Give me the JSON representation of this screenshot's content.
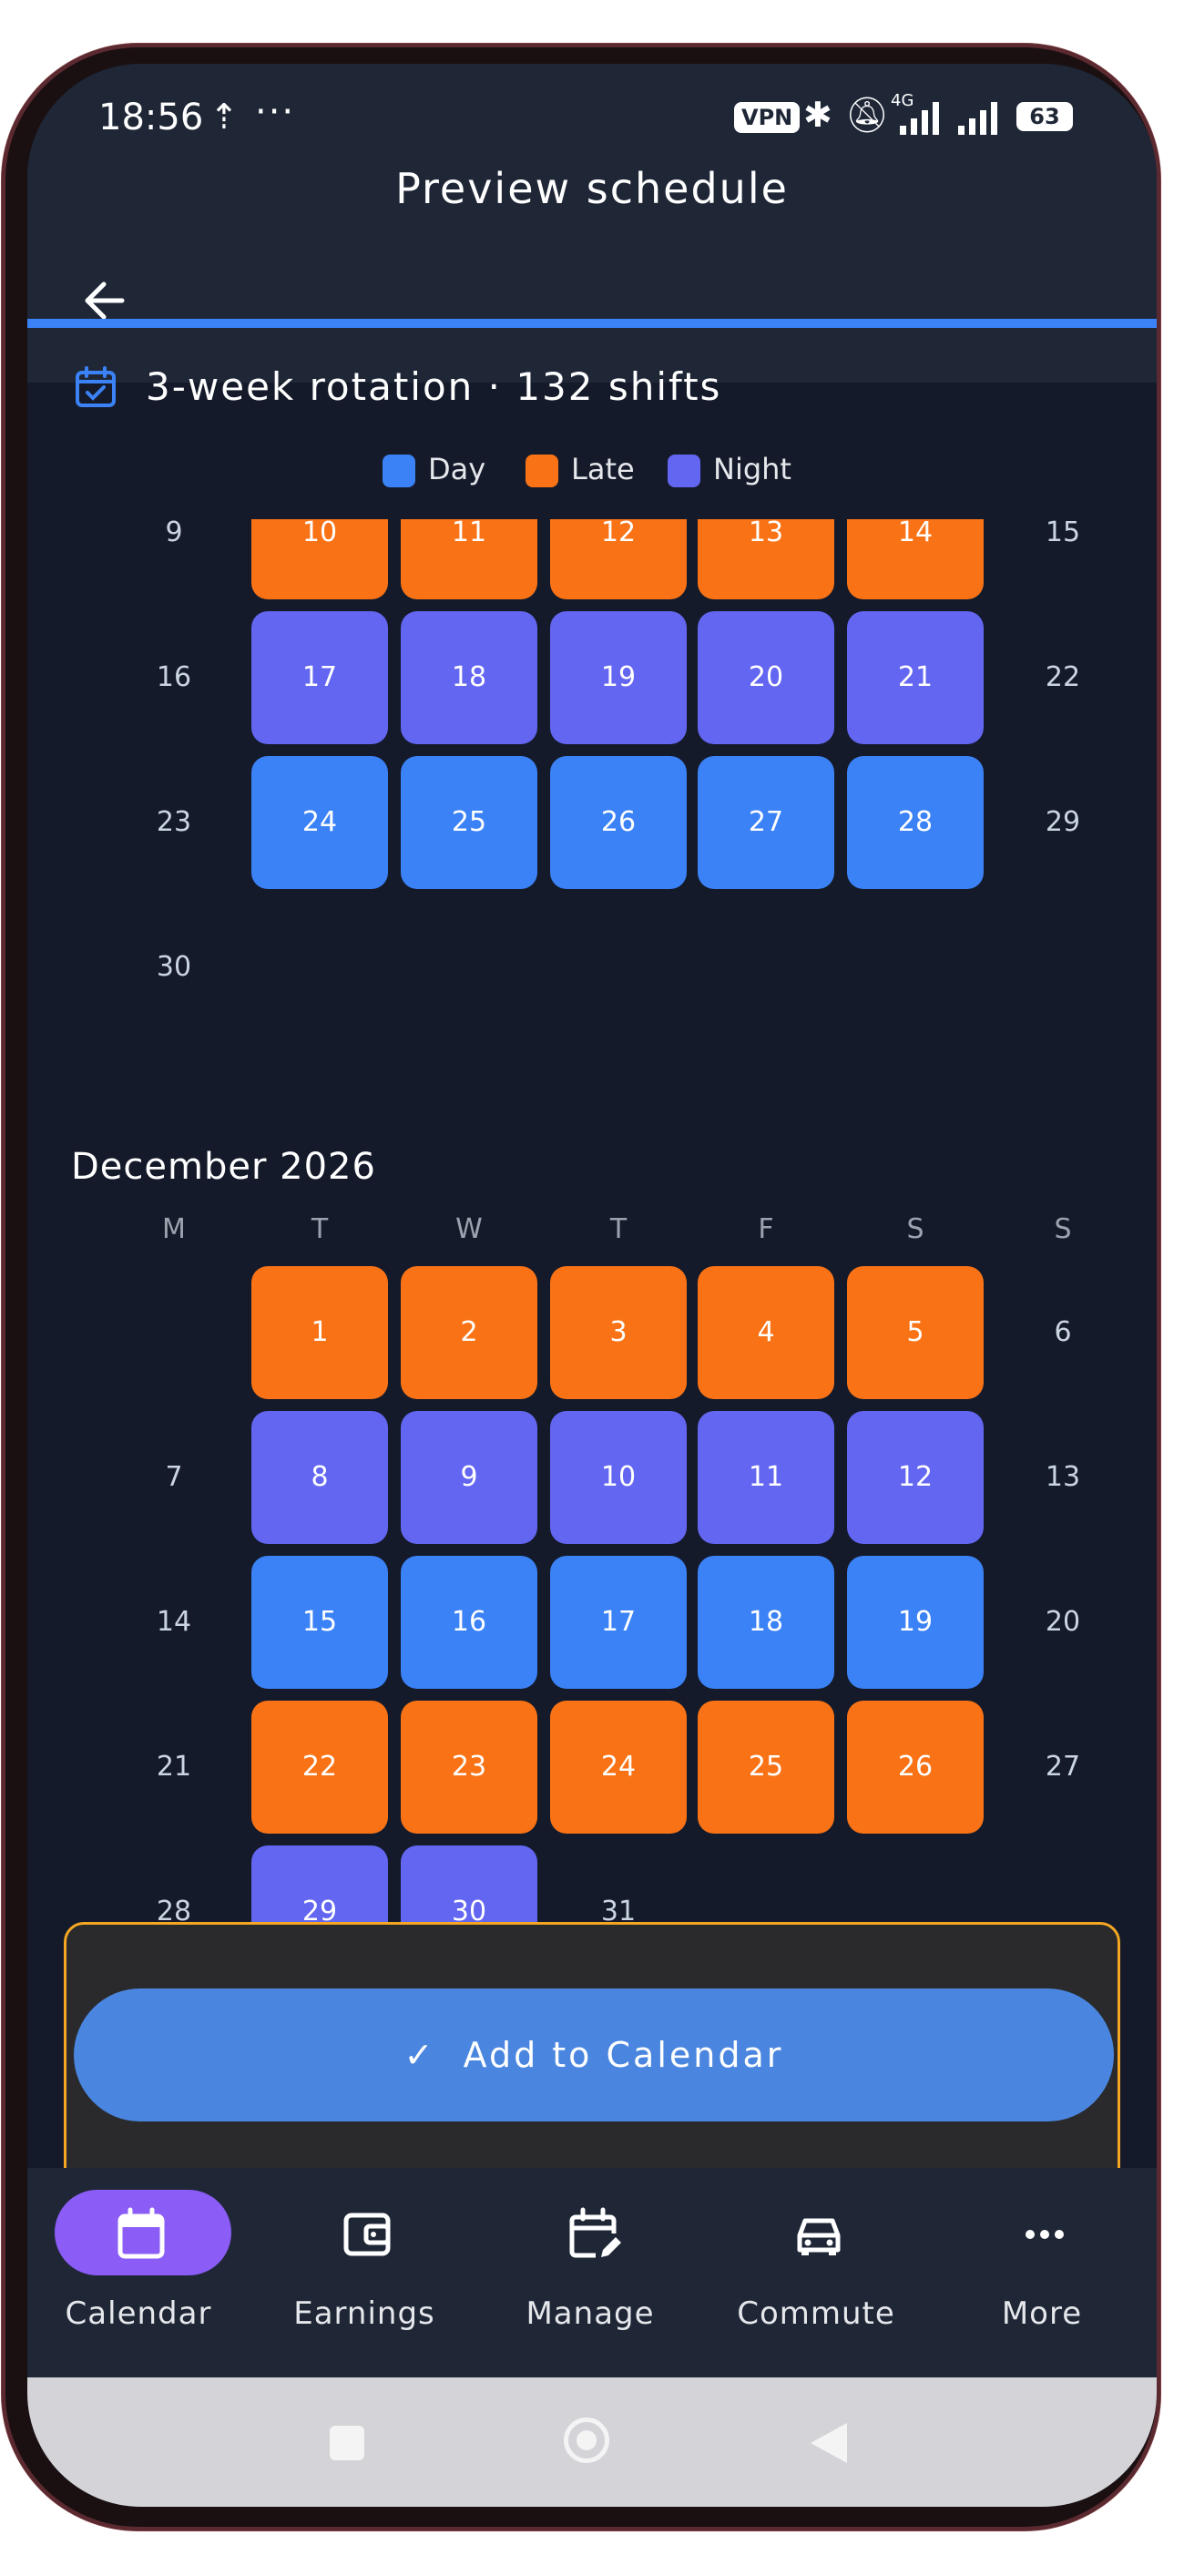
{
  "status_bar": {
    "time": "18:56",
    "vpn": "VPN",
    "network": "4G",
    "battery": "63"
  },
  "app_bar": {
    "title": "Preview schedule"
  },
  "summary": {
    "text": "3-week rotation · 132 shifts"
  },
  "legend": {
    "day": "Day",
    "late": "Late",
    "night": "Night"
  },
  "colors": {
    "day": "#3b82f6",
    "late": "#f97316",
    "night": "#6366f1",
    "accent": "#3b82f6",
    "nav_active": "#8b5cf6",
    "highlight_border": "#f5a623"
  },
  "november": {
    "weeks": [
      [
        {
          "d": "9",
          "s": ""
        },
        {
          "d": "10",
          "s": "late"
        },
        {
          "d": "11",
          "s": "late"
        },
        {
          "d": "12",
          "s": "late"
        },
        {
          "d": "13",
          "s": "late"
        },
        {
          "d": "14",
          "s": "late"
        },
        {
          "d": "15",
          "s": ""
        }
      ],
      [
        {
          "d": "16",
          "s": ""
        },
        {
          "d": "17",
          "s": "night"
        },
        {
          "d": "18",
          "s": "night"
        },
        {
          "d": "19",
          "s": "night"
        },
        {
          "d": "20",
          "s": "night"
        },
        {
          "d": "21",
          "s": "night"
        },
        {
          "d": "22",
          "s": ""
        }
      ],
      [
        {
          "d": "23",
          "s": ""
        },
        {
          "d": "24",
          "s": "day"
        },
        {
          "d": "25",
          "s": "day"
        },
        {
          "d": "26",
          "s": "day"
        },
        {
          "d": "27",
          "s": "day"
        },
        {
          "d": "28",
          "s": "day"
        },
        {
          "d": "29",
          "s": ""
        }
      ],
      [
        {
          "d": "30",
          "s": ""
        }
      ]
    ]
  },
  "december": {
    "title": "December 2026",
    "weekdays": [
      "M",
      "T",
      "W",
      "T",
      "F",
      "S",
      "S"
    ],
    "weeks": [
      [
        {
          "d": "",
          "s": ""
        },
        {
          "d": "1",
          "s": "late"
        },
        {
          "d": "2",
          "s": "late"
        },
        {
          "d": "3",
          "s": "late"
        },
        {
          "d": "4",
          "s": "late"
        },
        {
          "d": "5",
          "s": "late"
        },
        {
          "d": "6",
          "s": ""
        }
      ],
      [
        {
          "d": "7",
          "s": ""
        },
        {
          "d": "8",
          "s": "night"
        },
        {
          "d": "9",
          "s": "night"
        },
        {
          "d": "10",
          "s": "night"
        },
        {
          "d": "11",
          "s": "night"
        },
        {
          "d": "12",
          "s": "night"
        },
        {
          "d": "13",
          "s": ""
        }
      ],
      [
        {
          "d": "14",
          "s": ""
        },
        {
          "d": "15",
          "s": "day"
        },
        {
          "d": "16",
          "s": "day"
        },
        {
          "d": "17",
          "s": "day"
        },
        {
          "d": "18",
          "s": "day"
        },
        {
          "d": "19",
          "s": "day"
        },
        {
          "d": "20",
          "s": ""
        }
      ],
      [
        {
          "d": "21",
          "s": ""
        },
        {
          "d": "22",
          "s": "late"
        },
        {
          "d": "23",
          "s": "late"
        },
        {
          "d": "24",
          "s": "late"
        },
        {
          "d": "25",
          "s": "late"
        },
        {
          "d": "26",
          "s": "late"
        },
        {
          "d": "27",
          "s": ""
        }
      ],
      [
        {
          "d": "28",
          "s": ""
        },
        {
          "d": "29",
          "s": "night"
        },
        {
          "d": "30",
          "s": "night"
        },
        {
          "d": "31",
          "s": ""
        }
      ]
    ]
  },
  "add_button": {
    "label": "Add to Calendar"
  },
  "bottom_nav": {
    "items": [
      {
        "label": "Calendar",
        "icon": "calendar-icon",
        "active": true
      },
      {
        "label": "Earnings",
        "icon": "wallet-icon",
        "active": false
      },
      {
        "label": "Manage",
        "icon": "calendar-edit-icon",
        "active": false
      },
      {
        "label": "Commute",
        "icon": "car-icon",
        "active": false
      },
      {
        "label": "More",
        "icon": "more-icon",
        "active": false
      }
    ]
  }
}
